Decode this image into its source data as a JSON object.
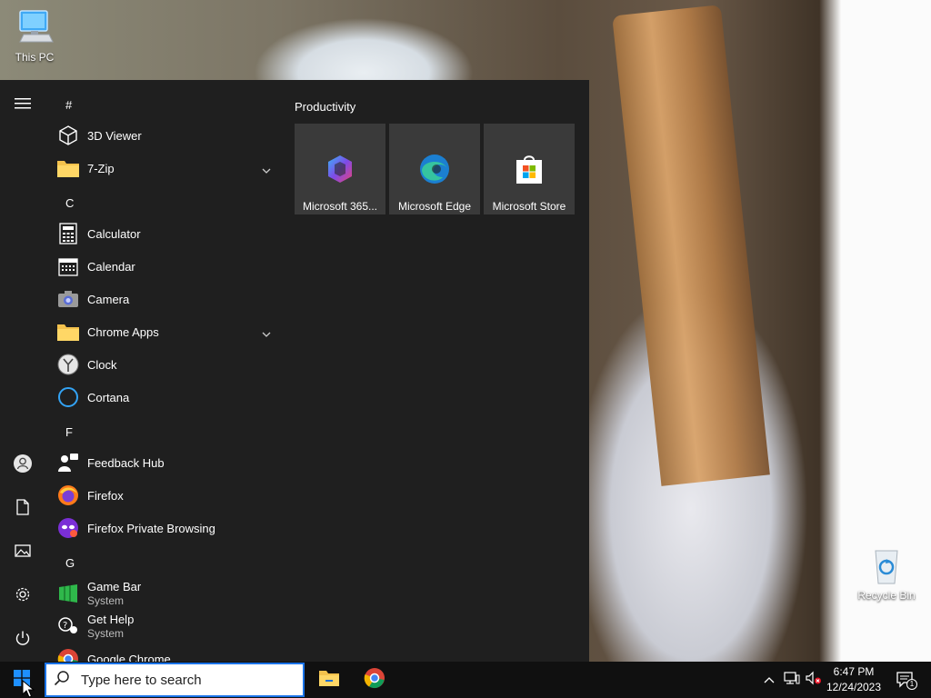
{
  "desktop": {
    "icons": [
      {
        "label": "This PC"
      },
      {
        "label": "Recycle Bin"
      }
    ]
  },
  "start_menu": {
    "letters": [
      "#",
      "C",
      "F",
      "G"
    ],
    "apps": [
      {
        "label": "3D Viewer"
      },
      {
        "label": "7-Zip"
      },
      {
        "label": "Calculator"
      },
      {
        "label": "Calendar"
      },
      {
        "label": "Camera"
      },
      {
        "label": "Chrome Apps"
      },
      {
        "label": "Clock"
      },
      {
        "label": "Cortana"
      },
      {
        "label": "Feedback Hub"
      },
      {
        "label": "Firefox"
      },
      {
        "label": "Firefox Private Browsing"
      },
      {
        "label": "Game Bar",
        "sub": "System"
      },
      {
        "label": "Get Help",
        "sub": "System"
      },
      {
        "label": "Google Chrome"
      }
    ],
    "tile_group": {
      "title": "Productivity",
      "tiles": [
        {
          "label": "Microsoft 365..."
        },
        {
          "label": "Microsoft Edge"
        },
        {
          "label": "Microsoft Store"
        }
      ]
    }
  },
  "taskbar": {
    "search": {
      "placeholder": "Type here to search"
    },
    "clock": {
      "time": "6:47 PM",
      "date": "12/24/2023"
    },
    "notifications": {
      "count": "1"
    }
  },
  "colors": {
    "start_bg": "#1f1f1f",
    "tile_bg": "#3a3a3a",
    "taskbar_bg": "#101010",
    "search_border": "#1a73e8",
    "windows_blue": "#1e90ff"
  }
}
